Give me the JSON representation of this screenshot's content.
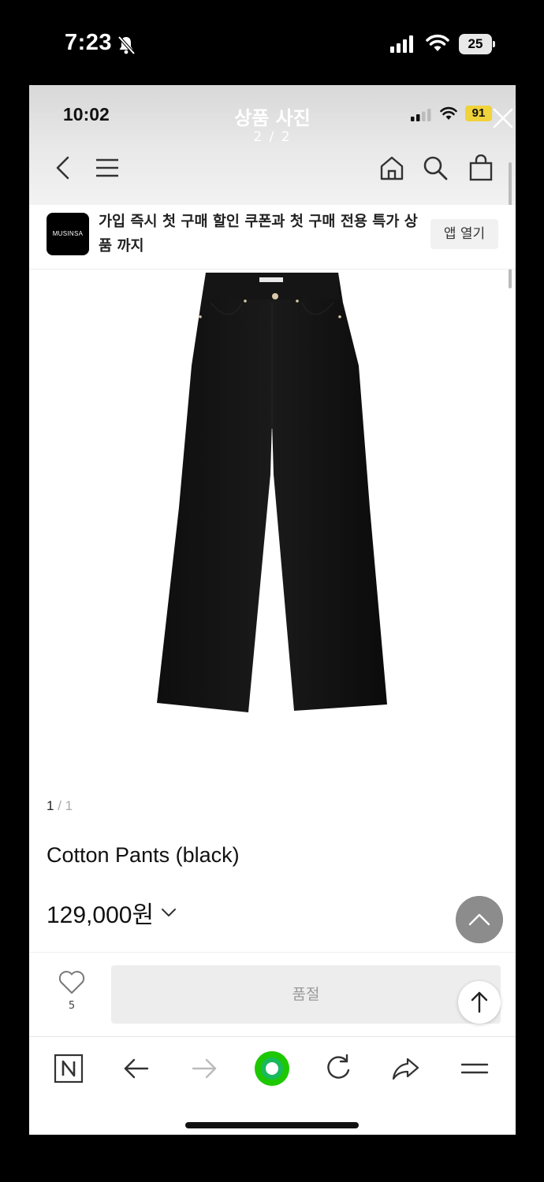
{
  "outer_status": {
    "time": "7:23",
    "battery": "25"
  },
  "inner_status": {
    "time": "10:02",
    "battery": "91"
  },
  "viewer": {
    "title": "상품 사진",
    "counter": "2 / 2"
  },
  "promo": {
    "logo_text": "MUSINSA",
    "text": "가입 즉시 첫 구매 할인 쿠폰과 첫 구매 전용 특가 상품 까지",
    "button_label": "앱 열기"
  },
  "product": {
    "image_counter_current": "1",
    "image_counter_total": "/ 1",
    "name": "Cotton Pants (black)",
    "price": "129,000원"
  },
  "buy_bar": {
    "like_count": "5",
    "soldout_label": "품절"
  },
  "colors": {
    "accent_green": "#1ec800",
    "soldout_bg": "#ededed",
    "battery_yellow": "#f0d23a"
  }
}
